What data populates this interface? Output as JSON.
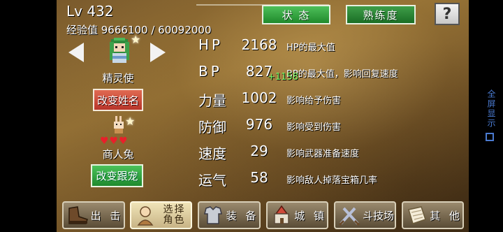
{
  "header": {
    "level": "Lv 432",
    "exp": "经验值 9666100 / 60092000",
    "tab_status": "状 态",
    "tab_proficiency": "熟练度",
    "help": "?"
  },
  "character": {
    "class_name": "精灵使",
    "rename_button": "改变姓名"
  },
  "pet": {
    "name": "商人兔",
    "hearts": "♥♥♥",
    "change_button": "改变跟宠"
  },
  "stats": [
    {
      "label": "HP",
      "value": "2168",
      "desc": "HP的最大值"
    },
    {
      "label": "BP",
      "value": "827",
      "desc": "BP的最大值，影响回复速度",
      "bonus": "+1158"
    },
    {
      "label": "力量",
      "value": "1002",
      "desc": "影响给予伤害"
    },
    {
      "label": "防御",
      "value": "976",
      "desc": "影响受到伤害"
    },
    {
      "label": "速度",
      "value": "29",
      "desc": "影响武器准备速度"
    },
    {
      "label": "运气",
      "value": "58",
      "desc": "影响敌人掉落宝箱几率"
    }
  ],
  "nav": {
    "sortie": "出 击",
    "select_char_line1": "选择",
    "select_char_line2": "角色",
    "equipment": "装 备",
    "town": "城 镇",
    "arena": "斗技场",
    "other": "其 他"
  },
  "system": {
    "fullscreen": "全屏显示"
  },
  "colors": {
    "green_tab": "#2e9a3a",
    "red_button": "#c8402e",
    "hp_bonus": "#7cff6a",
    "side_text": "#4a7ad0"
  },
  "icons": [
    "arrow-left-icon",
    "arrow-right-icon",
    "star-icon",
    "help-icon",
    "boot-icon",
    "character-icon",
    "armor-icon",
    "castle-icon",
    "sword-icon",
    "scroll-icon",
    "fullscreen-icon"
  ]
}
